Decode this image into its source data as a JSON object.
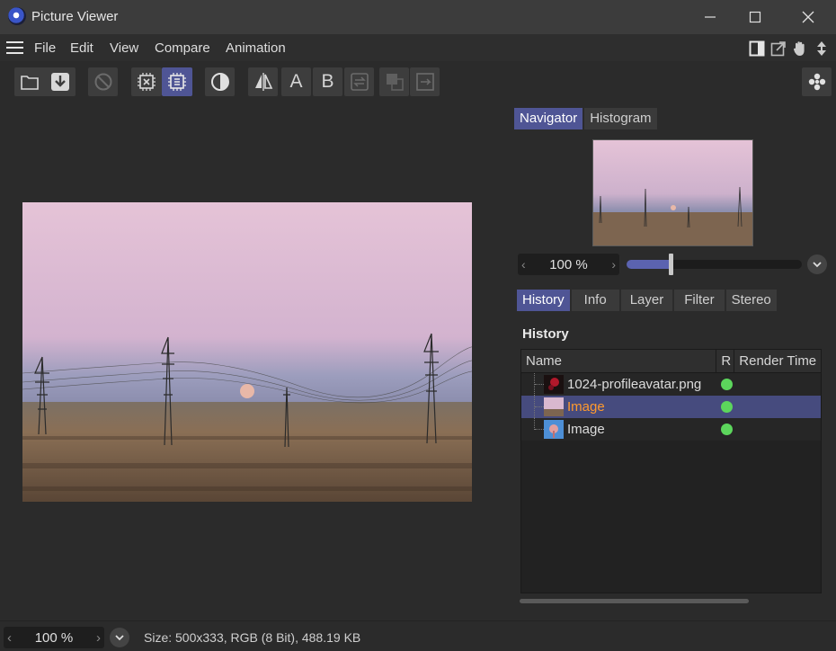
{
  "window": {
    "title": "Picture Viewer",
    "minimize_icon": "minimize-icon",
    "maximize_icon": "maximize-icon",
    "close_icon": "close-icon"
  },
  "menu": {
    "items": [
      {
        "label": "File"
      },
      {
        "label": "Edit"
      },
      {
        "label": "View"
      },
      {
        "label": "Compare"
      },
      {
        "label": "Animation"
      }
    ]
  },
  "toolbar": {
    "letter_a": "A",
    "letter_b": "B"
  },
  "navigator": {
    "tabs": [
      {
        "label": "Navigator",
        "active": true
      },
      {
        "label": "Histogram",
        "active": false
      }
    ],
    "zoom_value": "100 %",
    "zoom_slider_fraction": 0.25
  },
  "info_tabs": [
    {
      "label": "History",
      "active": true
    },
    {
      "label": "Info",
      "active": false
    },
    {
      "label": "Layer",
      "active": false
    },
    {
      "label": "Filter",
      "active": false
    },
    {
      "label": "Stereo",
      "active": false
    }
  ],
  "history": {
    "title": "History",
    "columns": [
      "Name",
      "R",
      "Render Time"
    ],
    "rows": [
      {
        "name": "1024-profileavatar.png",
        "selected": false,
        "thumb": "avatar"
      },
      {
        "name": "Image",
        "selected": true,
        "thumb": "landscape"
      },
      {
        "name": "Image",
        "selected": false,
        "thumb": "blue"
      }
    ]
  },
  "status": {
    "zoom_value": "100 %",
    "info": "Size: 500x333, RGB (8 Bit), 488.19 KB"
  },
  "colors": {
    "accent": "#4f5595",
    "selected_name": "#ff9a2e",
    "render_dot": "#5cd65c"
  }
}
